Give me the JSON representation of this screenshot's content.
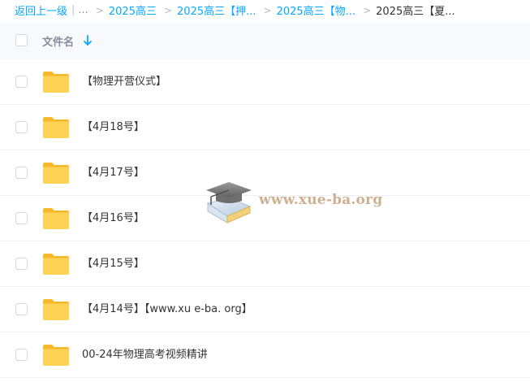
{
  "breadcrumb": {
    "back_label": "返回上一级",
    "ellipsis": "...",
    "separator": ">",
    "items": [
      "2025高三",
      "2025高三【押...",
      "2025高三【物...",
      "2025高三【夏..."
    ]
  },
  "list_header": {
    "column_label": "文件名",
    "sort_icon": "arrow-down-icon"
  },
  "rows": [
    {
      "name": "【物理开营仪式】",
      "icon": "folder-icon"
    },
    {
      "name": "【4月18号】",
      "icon": "folder-icon"
    },
    {
      "name": "【4月17号】",
      "icon": "folder-icon"
    },
    {
      "name": "【4月16号】",
      "icon": "folder-icon"
    },
    {
      "name": "【4月15号】",
      "icon": "folder-icon"
    },
    {
      "name": "【4月14号】【www.xu e-ba. org】",
      "icon": "folder-icon"
    },
    {
      "name": "00-24年物理高考视频精讲",
      "icon": "folder-icon"
    }
  ],
  "watermark": {
    "text": "www.xue-ba.org",
    "icon": "graduation-cap-icon"
  },
  "colors": {
    "link": "#06a7ff",
    "folder": "#ffd155",
    "folder_back": "#f5b92a",
    "header_bg": "#f7f9fc",
    "watermark_text": "#c9a886"
  }
}
